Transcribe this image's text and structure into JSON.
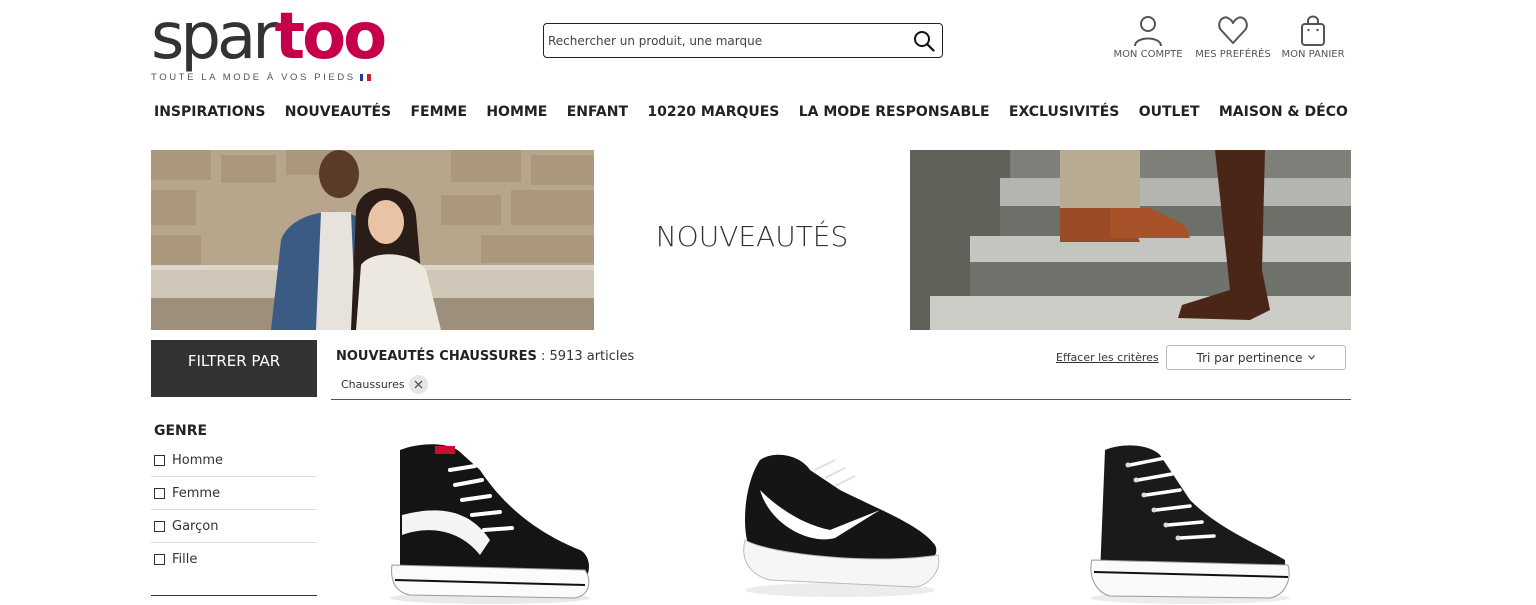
{
  "header": {
    "logo_part1": "spar",
    "logo_part2": "too",
    "tagline": "TOUTE LA MODE À VOS PIEDS",
    "search_placeholder": "Rechercher un produit, une marque",
    "account_label": "MON COMPTE",
    "favorites_label": "MES PREFÉRÉS",
    "cart_label": "MON PANIER"
  },
  "nav": [
    "INSPIRATIONS",
    "NOUVEAUTÉS",
    "FEMME",
    "HOMME",
    "ENFANT",
    "10220 MARQUES",
    "LA MODE RESPONSABLE",
    "EXCLUSIVITÉS",
    "OUTLET",
    "MAISON & DÉCO"
  ],
  "banner": {
    "title": "NOUVEAUTÉS"
  },
  "sidebar": {
    "filter_label": "FILTRER PAR",
    "genre_title": "GENRE",
    "genre_options": [
      "Homme",
      "Femme",
      "Garçon",
      "Fille"
    ]
  },
  "results": {
    "title": "NOUVEAUTÉS CHAUSSURES",
    "count_text": " : 5913 articles",
    "active_filter": "Chaussures",
    "clear_label": "Effacer les critères",
    "sort_label": "Tri par pertinence"
  },
  "colors": {
    "brand": "#c4004b",
    "dark": "#333333"
  }
}
